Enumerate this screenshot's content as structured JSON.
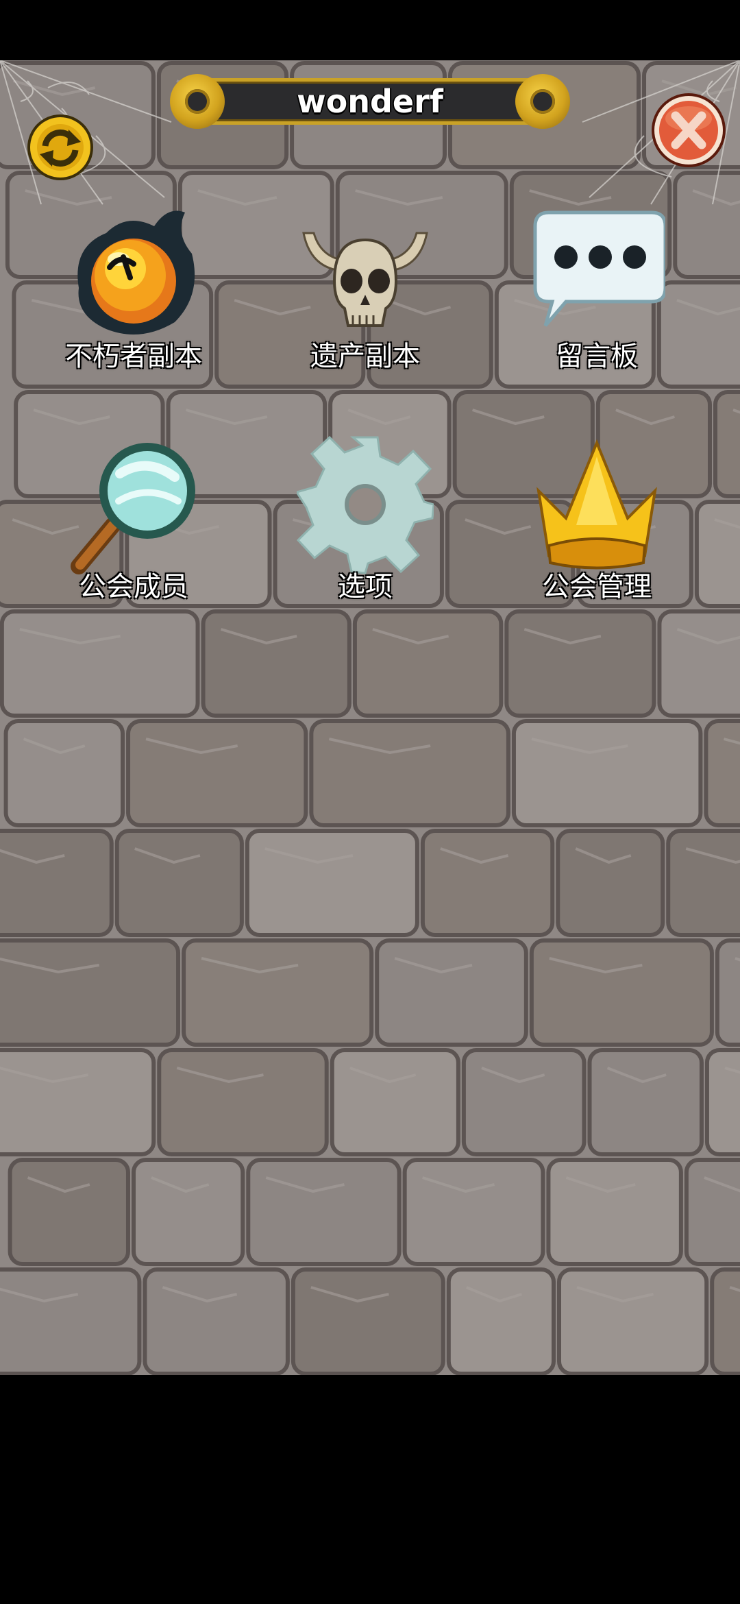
{
  "header": {
    "title": "wonderf",
    "refresh_icon": "refresh-circular-arrow-icon",
    "close_icon": "close-x-icon"
  },
  "menu": {
    "items": [
      {
        "label": "不朽者副本",
        "icon": "dark-orb-icon"
      },
      {
        "label": "遗产副本",
        "icon": "horned-skull-icon"
      },
      {
        "label": "留言板",
        "icon": "speech-bubble-icon"
      },
      {
        "label": "公会成员",
        "icon": "magnifier-icon"
      },
      {
        "label": "选项",
        "icon": "gear-icon"
      },
      {
        "label": "公会管理",
        "icon": "crown-icon"
      }
    ]
  },
  "colors": {
    "accent_gold": "#c9a227",
    "close_red": "#e25b3a",
    "title_bar_bg": "#2b2b2d",
    "stone": "#8f8885"
  }
}
